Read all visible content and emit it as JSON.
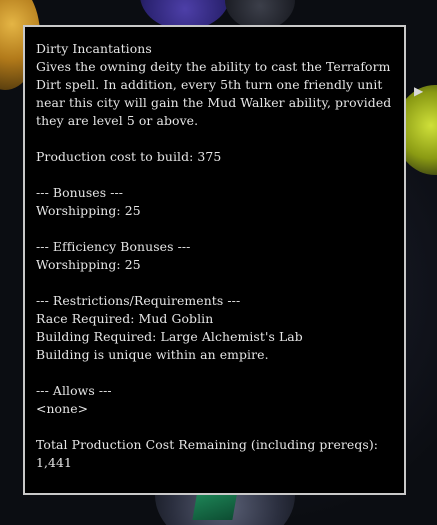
{
  "tooltip": {
    "title": "Dirty Incantations",
    "description_lines": [
      "Gives the owning deity the ability to cast the Terraform",
      "Dirt spell. In addition, every 5th turn one friendly unit",
      "near this city will gain the Mud Walker ability, provided",
      "they are level 5 or above."
    ],
    "production_cost": "Production cost to build: 375",
    "bonuses_header": "--- Bonuses ---",
    "bonuses_value": "Worshipping: 25",
    "efficiency_header": "--- Efficiency Bonuses ---",
    "efficiency_value": "Worshipping: 25",
    "restrictions_header": "--- Restrictions/Requirements ---",
    "race_required": "Race Required: Mud Goblin",
    "building_required": "Building Required: Large Alchemist's Lab",
    "unique_note": "Building is unique within an empire.",
    "allows_header": "--- Allows ---",
    "allows_value": "<none>",
    "total_label": "Total Production Cost Remaining (including prereqs):",
    "total_value": "1,441"
  },
  "colors": {
    "tooltip_background": "#000000",
    "tooltip_border": "#c9c9c9",
    "tooltip_text": "#e6e6e6"
  },
  "icons": [
    "play-triangle-icon"
  ]
}
